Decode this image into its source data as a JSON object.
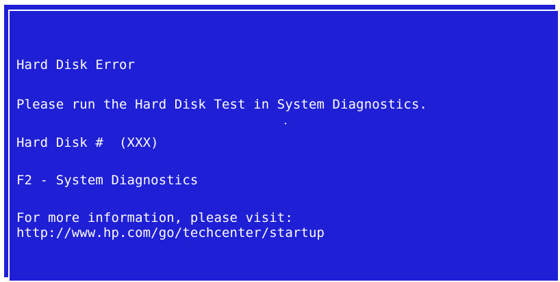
{
  "error_screen": {
    "title": "Hard Disk Error",
    "instruction": "Please run the Hard Disk Test in System Diagnostics.",
    "disk_label": "Hard Disk #  (XXX)",
    "diagnostics_option": "F2 - System Diagnostics",
    "info_prompt": "For more information, please visit:",
    "info_url": "http://www.hp.com/go/techcenter/startup"
  },
  "colors": {
    "background": "#1f1fd6",
    "text": "#ffffff",
    "border": "#ffffff"
  }
}
